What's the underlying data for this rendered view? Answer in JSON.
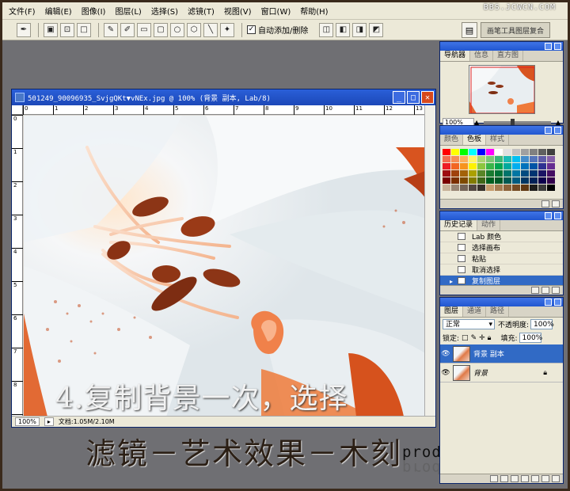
{
  "menu": [
    "文件(F)",
    "编辑(E)",
    "图像(I)",
    "图层(L)",
    "选择(S)",
    "滤镜(T)",
    "视图(V)",
    "窗口(W)",
    "帮助(H)"
  ],
  "site_watermark": "BBS.JCWCN.COM",
  "options_bar": {
    "auto_add_delete_label": "自动添加/删除",
    "auto_add_delete_checked": "✓",
    "palette_well_label": "画笔工具图层复合"
  },
  "document": {
    "title": "501249_90096935_SvjgQKt▼vNEx.jpg @ 100% (背景 副本, Lab/8)",
    "zoom": "100%",
    "file_size": "文档:1.05M/2.10M",
    "ruler_h": [
      "0",
      "1",
      "2",
      "3",
      "4",
      "5",
      "6",
      "7",
      "8",
      "9",
      "10",
      "11",
      "12",
      "13"
    ],
    "ruler_v": [
      "0",
      "1",
      "2",
      "3",
      "4",
      "5",
      "6",
      "7",
      "8",
      "9"
    ]
  },
  "captions": {
    "line1": "4.复制背景一次，选择",
    "line2": "滤镜－艺术效果－木刻"
  },
  "signature": {
    "text": "producer tect"
  },
  "navigator_panel": {
    "tabs": [
      "导航器",
      "信息",
      "直方图"
    ],
    "zoom": "100%"
  },
  "color_panel": {
    "tabs": [
      "颜色",
      "色板",
      "样式"
    ],
    "swatch_colors": [
      "#ff0000",
      "#ffff00",
      "#00ff00",
      "#00ffff",
      "#0000ff",
      "#ff00ff",
      "#ffffff",
      "#e0e0e0",
      "#c0c0c0",
      "#a0a0a0",
      "#808080",
      "#606060",
      "#404040",
      "#f26c4f",
      "#f68e56",
      "#fbaf5c",
      "#fff467",
      "#acd372",
      "#7cc576",
      "#3bb878",
      "#1abbb4",
      "#00bff3",
      "#438ccb",
      "#5574b9",
      "#605ca8",
      "#855fa8",
      "#ed1c24",
      "#f26522",
      "#f7941d",
      "#fff200",
      "#8dc63f",
      "#39b54a",
      "#00a651",
      "#00a99d",
      "#00aeef",
      "#0072bc",
      "#0054a6",
      "#2e3192",
      "#662d91",
      "#9e0b0f",
      "#a0410d",
      "#a36209",
      "#aba000",
      "#598527",
      "#197b30",
      "#007236",
      "#00746b",
      "#0076a3",
      "#004b80",
      "#003471",
      "#1b1464",
      "#440e62",
      "#790000",
      "#7b2e00",
      "#7d4900",
      "#827b00",
      "#406618",
      "#005e20",
      "#005826",
      "#005952",
      "#005b7f",
      "#003663",
      "#002157",
      "#0d004c",
      "#32004b",
      "#c7b299",
      "#998675",
      "#736357",
      "#534741",
      "#37302a",
      "#c69c6d",
      "#a67c52",
      "#8c6239",
      "#754c24",
      "#603913",
      "#1d1d1b",
      "#3c3c3b",
      "#000000"
    ]
  },
  "history_panel": {
    "tabs": [
      "历史记录",
      "动作"
    ],
    "items": [
      "Lab 颜色",
      "选择画布",
      "粘贴",
      "取消选择",
      "复制图层"
    ],
    "selected_index": 4
  },
  "layers_panel": {
    "tabs": [
      "图层",
      "通道",
      "路径"
    ],
    "blend_mode": "正常",
    "opacity_label": "不透明度:",
    "opacity": "100%",
    "lock_label": "锁定:",
    "fill_label": "填充:",
    "fill": "100%",
    "layers": [
      "背景 副本",
      "背景"
    ]
  }
}
